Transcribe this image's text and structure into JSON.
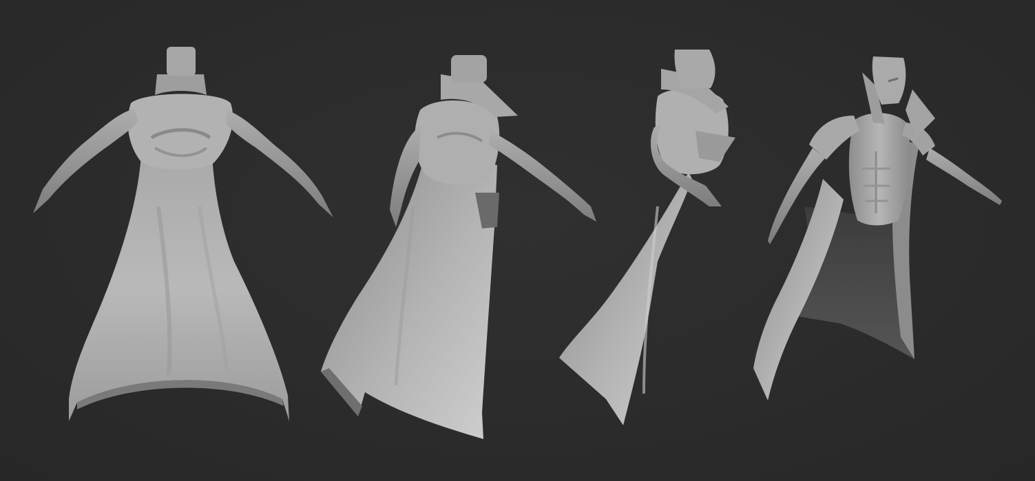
{
  "scene": {
    "background_color": "#2b2b2b",
    "clay_light": "#c4c4c4",
    "clay_mid": "#9a9a9a",
    "clay_dark": "#5e5e5e",
    "clay_shadow": "#3a3a3a",
    "views": [
      {
        "id": "back-view"
      },
      {
        "id": "three-quarter-back-view"
      },
      {
        "id": "side-view"
      },
      {
        "id": "three-quarter-front-view"
      }
    ]
  }
}
